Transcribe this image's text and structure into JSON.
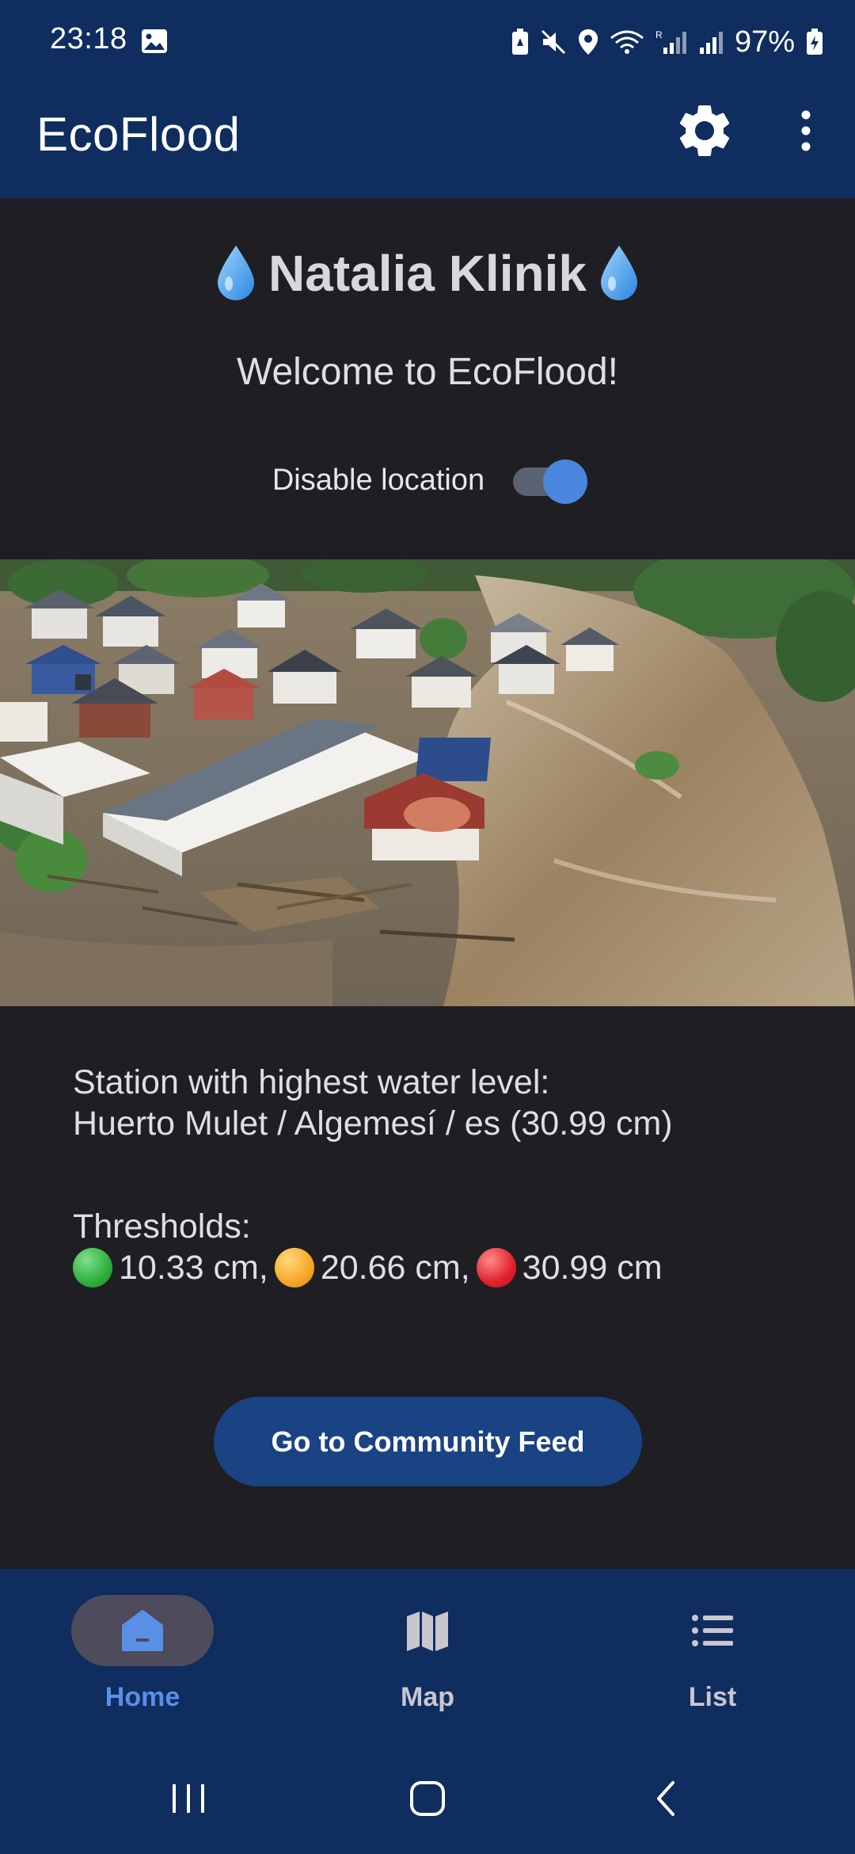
{
  "status_bar": {
    "time": "23:18",
    "battery": "97%"
  },
  "app_bar": {
    "title": "EcoFlood",
    "settings_icon": "gear-icon",
    "more_icon": "more-vert-icon"
  },
  "profile": {
    "name": "Natalia Klinik",
    "welcome": "Welcome to EcoFlood!"
  },
  "location": {
    "label": "Disable location",
    "enabled": true
  },
  "station": {
    "heading": "Station with highest water level:",
    "value": "Huerto Mulet / Algemesí / es (30.99 cm)"
  },
  "thresholds": {
    "heading": "Thresholds:",
    "levels": [
      {
        "color": "green",
        "text": "10.33 cm,"
      },
      {
        "color": "yellow",
        "text": "20.66 cm,"
      },
      {
        "color": "red",
        "text": "30.99 cm"
      }
    ]
  },
  "actions": {
    "community_feed": "Go to Community Feed"
  },
  "bottom_nav": {
    "items": [
      {
        "label": "Home",
        "icon": "home-icon",
        "active": true
      },
      {
        "label": "Map",
        "icon": "map-icon",
        "active": false
      },
      {
        "label": "List",
        "icon": "list-icon",
        "active": false
      }
    ]
  },
  "colors": {
    "bar_background": "#0f2d5e",
    "content_background": "#1f1e23",
    "accent": "#4b86de",
    "button": "#1a4384"
  }
}
